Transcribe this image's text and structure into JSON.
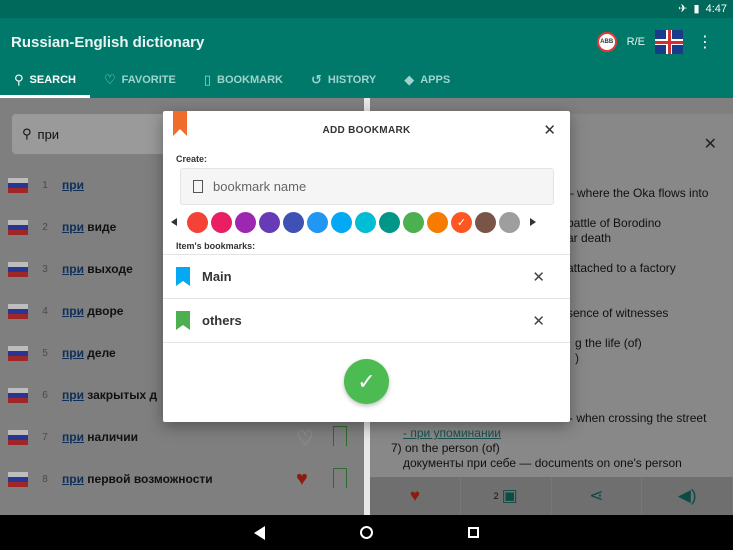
{
  "status_bar": {
    "airplane_icon": "airplane-icon",
    "battery_icon": "battery-icon",
    "time": "4:47"
  },
  "app": {
    "title": "Russian-English dictionary",
    "lang_label": "R/E",
    "tabs": [
      {
        "label": "SEARCH",
        "icon": "search-icon",
        "active": true
      },
      {
        "label": "FAVORITE",
        "icon": "heart-icon",
        "active": false
      },
      {
        "label": "BOOKMARK",
        "icon": "bookmark-icon",
        "active": false
      },
      {
        "label": "HISTORY",
        "icon": "history-icon",
        "active": false
      },
      {
        "label": "APPS",
        "icon": "android-icon",
        "active": false
      }
    ]
  },
  "search": {
    "query": "при"
  },
  "word_list": [
    {
      "num": "1",
      "prefix": "при",
      "rest": ""
    },
    {
      "num": "2",
      "prefix": "при",
      "rest": " виде"
    },
    {
      "num": "3",
      "prefix": "при",
      "rest": " выходе"
    },
    {
      "num": "4",
      "prefix": "при",
      "rest": " дворе"
    },
    {
      "num": "5",
      "prefix": "при",
      "rest": " деле"
    },
    {
      "num": "6",
      "prefix": "при",
      "rest": " закрытых д"
    },
    {
      "num": "7",
      "prefix": "при",
      "rest": " наличии"
    },
    {
      "num": "8",
      "prefix": "при",
      "rest": " первой возможности"
    }
  ],
  "article": {
    "lines": [
      "– where the Oka flows into",
      "battle of Borodino",
      "ar death",
      "attached to a factory",
      "sence of witnesses",
      "g the life (of)",
      ")",
      "- when crossing the street",
      "- при упоминании",
      "7) on the person (of)",
      "документы при себе — documents on one's person"
    ],
    "bookmark_count": "2"
  },
  "dialog": {
    "title": "ADD BOOKMARK",
    "create_label": "Create:",
    "input_placeholder": "bookmark name",
    "items_label": "Item's bookmarks:",
    "colors": [
      "#f44336",
      "#e91e63",
      "#9c27b0",
      "#673ab7",
      "#3f51b5",
      "#2196f3",
      "#03a9f4",
      "#00bcd4",
      "#009688",
      "#4caf50",
      "#f57c00",
      "#ff5722",
      "#795548",
      "#9e9e9e"
    ],
    "selected_color_index": 11,
    "bookmarks": [
      {
        "name": "Main",
        "color": "#03a9f4"
      },
      {
        "name": "others",
        "color": "#4caf50"
      }
    ]
  }
}
